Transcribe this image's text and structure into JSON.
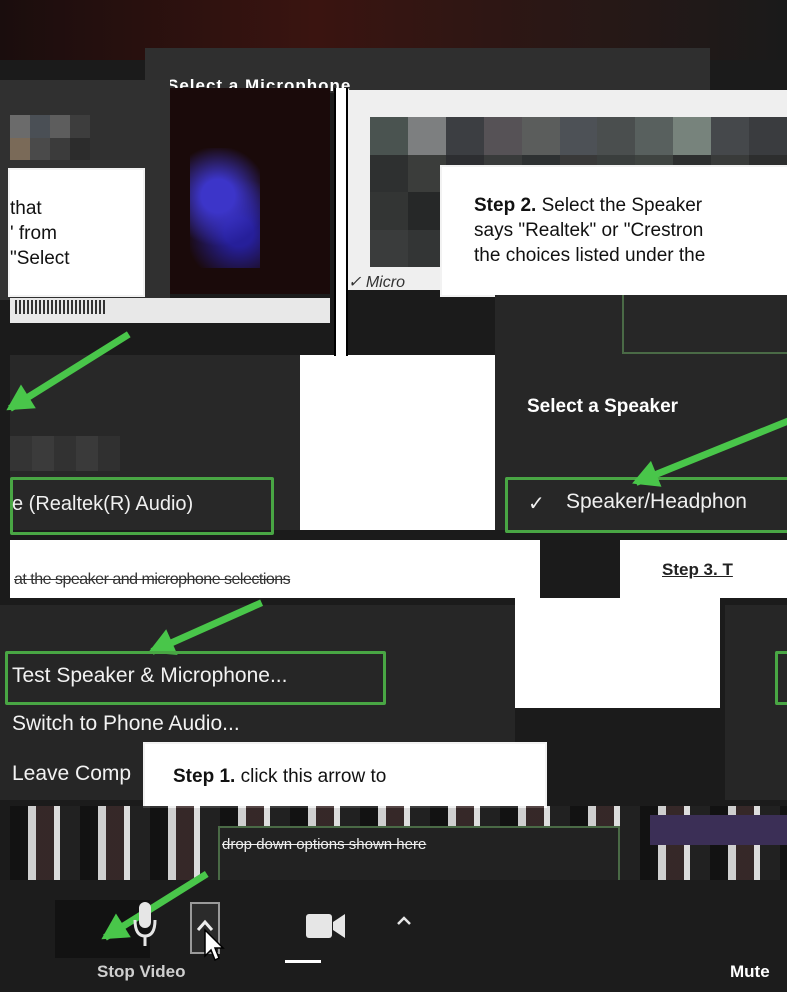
{
  "dialog_title": "Select a Microphone",
  "callout_left": {
    "lines": [
      "that",
      "' from",
      "\"Select"
    ]
  },
  "callout_step2": {
    "strong": "Step 2.",
    "lines": [
      "Select the Speaker",
      "says \"Realtek\" or \"Crestron",
      "the choices listed under the"
    ]
  },
  "microphone_check_label": "✓ Micro",
  "speaker_menu": {
    "title": "Select a Speaker",
    "selected_item": "Speaker/Headphon",
    "check": "✓"
  },
  "mic_item": "e (Realtek(R) Audio)",
  "audio_menu": {
    "test": "Test Speaker & Microphone...",
    "switch": "Switch to Phone Audio...",
    "leave": "Leave Comp"
  },
  "callout_step1": {
    "strong": "Step 1.",
    "rest": "click this arrow to"
  },
  "callout_step3_partial": "Step 3. T",
  "garbled_middle_text": "at the speaker and microphone selections",
  "garbled_bottom_text": "drop down options shown here",
  "toolbar": {
    "stop_video": "Stop Video",
    "mute": "Mute"
  },
  "colors": {
    "highlight_green": "#49a644",
    "arrow_green": "#49c64a",
    "panel": "#262626"
  }
}
